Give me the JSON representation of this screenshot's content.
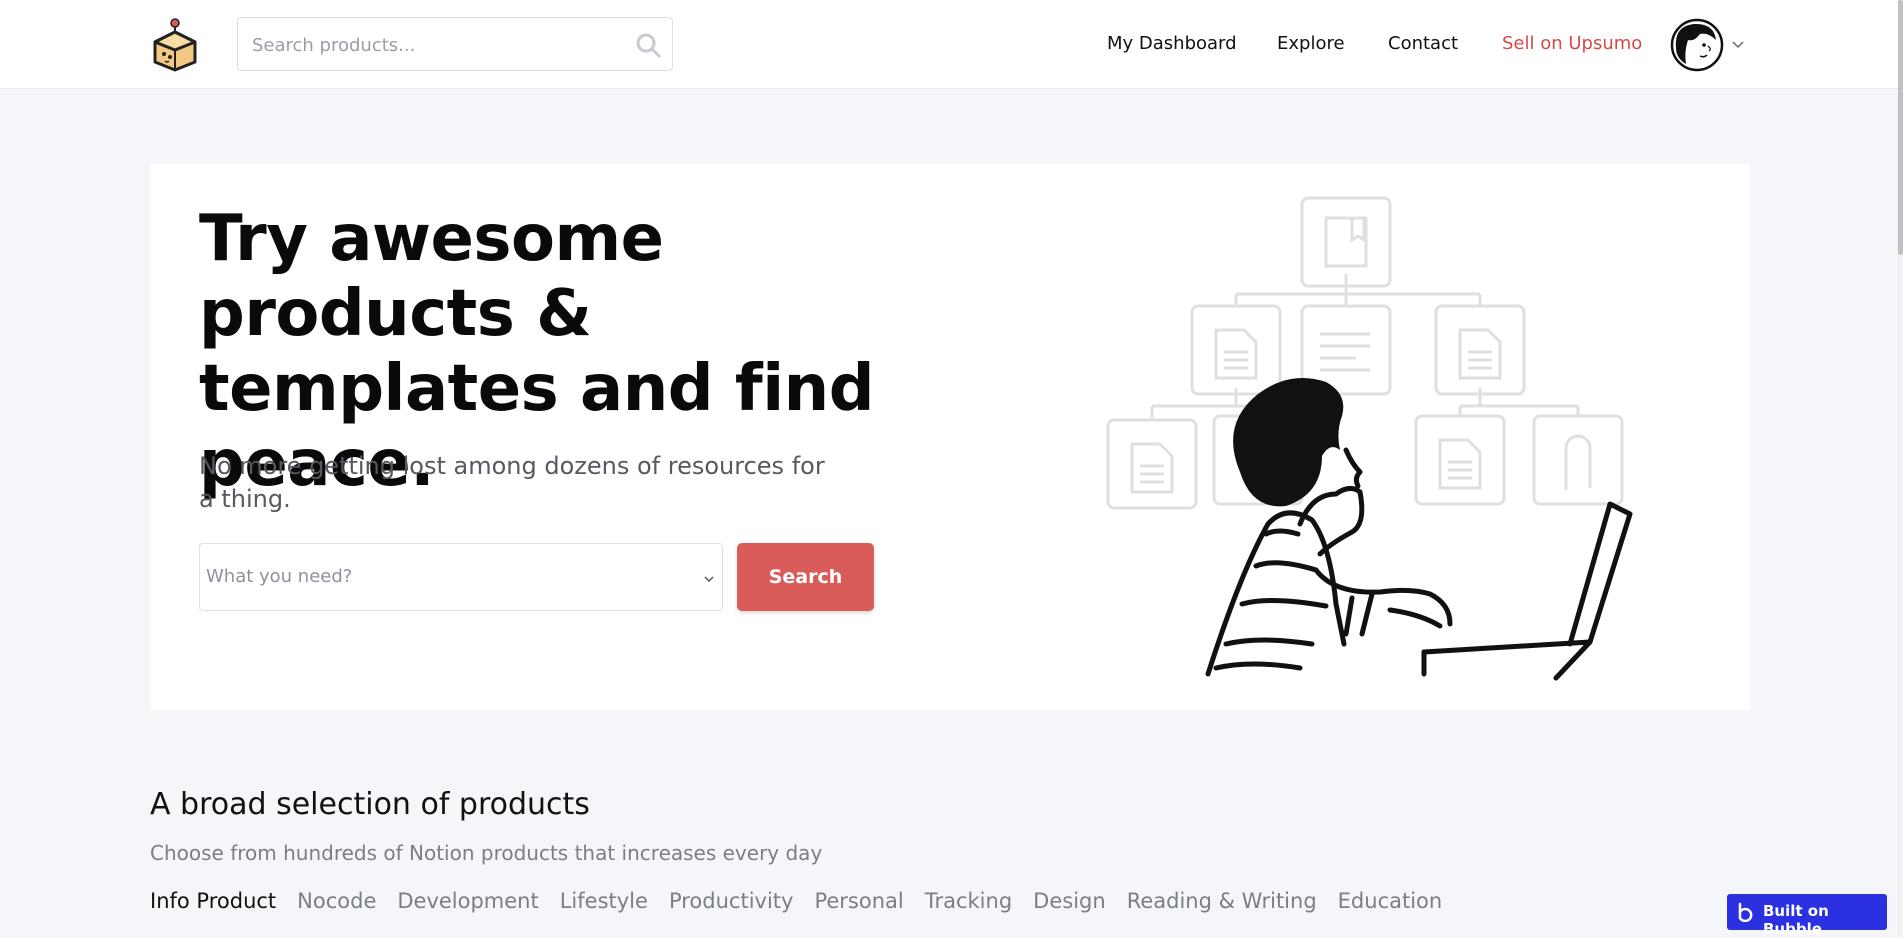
{
  "header": {
    "search_placeholder": "Search products...",
    "nav": [
      {
        "label": "My Dashboard"
      },
      {
        "label": "Explore"
      },
      {
        "label": "Contact"
      },
      {
        "label": "Sell on Upsumo",
        "accent": "#d44a4a"
      }
    ]
  },
  "hero": {
    "title": "Try awesome products & templates and find peace.",
    "subtitle": "No more getting lost among dozens of resources for a thing.",
    "select_placeholder": "What you need?",
    "search_button": "Search"
  },
  "products_section": {
    "title": "A broad selection of products",
    "subtitle": "Choose from hundreds of Notion products that increases every day",
    "categories": [
      {
        "label": "Info Product",
        "active": true
      },
      {
        "label": "Nocode"
      },
      {
        "label": "Development"
      },
      {
        "label": "Lifestyle"
      },
      {
        "label": "Productivity"
      },
      {
        "label": "Personal"
      },
      {
        "label": "Tracking"
      },
      {
        "label": "Design"
      },
      {
        "label": "Reading & Writing"
      },
      {
        "label": "Education"
      }
    ]
  },
  "badge": {
    "label": "Built on Bubble"
  },
  "colors": {
    "accent": "#d95c5a",
    "background": "#f4f6f9",
    "badge": "#2b31e0"
  },
  "icons": [
    "box-logo-icon",
    "search-icon",
    "avatar",
    "chevron-down-icon",
    "bubble-logo-icon"
  ]
}
